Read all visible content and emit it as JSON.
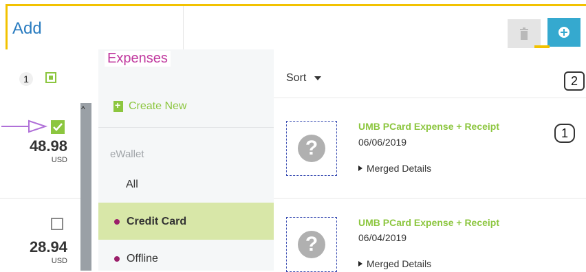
{
  "header": {
    "title": "Add",
    "trash_icon": "trash-icon",
    "add_icon": "plus-circle-icon"
  },
  "selection": {
    "step_badge": "1"
  },
  "nav": {
    "title": "Expenses",
    "create_new": "Create New",
    "section": "eWallet",
    "items": [
      {
        "label": "All"
      },
      {
        "label": "Credit Card",
        "active": true
      },
      {
        "label": "Offline"
      }
    ]
  },
  "list": {
    "sort_label": "Sort",
    "callout_sort": "2",
    "callout_item": "1",
    "rows": [
      {
        "checked": true,
        "amount": "48.98",
        "currency": "USD"
      },
      {
        "checked": false,
        "amount": "28.94",
        "currency": "USD"
      }
    ],
    "items": [
      {
        "title": "UMB PCard Expense + Receipt",
        "date": "06/06/2019",
        "merged": "Merged Details"
      },
      {
        "title": "UMB PCard Expense + Receipt",
        "date": "06/04/2019",
        "merged": "Merged Details"
      }
    ]
  },
  "colors": {
    "accent_green": "#8cc63f",
    "accent_blue": "#35a9cf",
    "frame_yellow": "#f2c200",
    "title_magenta": "#c0389e"
  }
}
